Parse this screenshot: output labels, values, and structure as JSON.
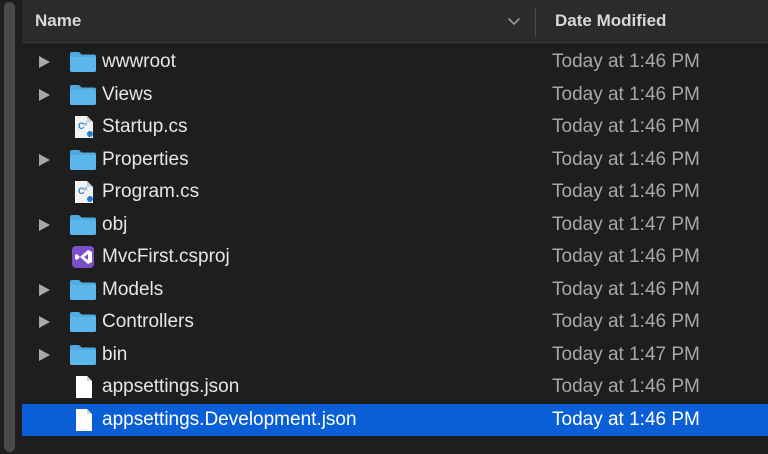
{
  "header": {
    "name_label": "Name",
    "date_label": "Date Modified",
    "sort_icon": "chevron-down-icon"
  },
  "colors": {
    "folder": "#4fa9e3",
    "selection": "#0a5fd6",
    "csharp": "#1e7fd6",
    "vs_purple": "#7b4fc9"
  },
  "files": [
    {
      "name": "wwwroot",
      "date": "Today at 1:46 PM",
      "kind": "folder",
      "expandable": true,
      "selected": false
    },
    {
      "name": "Views",
      "date": "Today at 1:46 PM",
      "kind": "folder",
      "expandable": true,
      "selected": false
    },
    {
      "name": "Startup.cs",
      "date": "Today at 1:46 PM",
      "kind": "csharp",
      "expandable": false,
      "selected": false
    },
    {
      "name": "Properties",
      "date": "Today at 1:46 PM",
      "kind": "folder",
      "expandable": true,
      "selected": false
    },
    {
      "name": "Program.cs",
      "date": "Today at 1:46 PM",
      "kind": "csharp",
      "expandable": false,
      "selected": false
    },
    {
      "name": "obj",
      "date": "Today at 1:47 PM",
      "kind": "folder",
      "expandable": true,
      "selected": false
    },
    {
      "name": "MvcFirst.csproj",
      "date": "Today at 1:46 PM",
      "kind": "csproj",
      "expandable": false,
      "selected": false
    },
    {
      "name": "Models",
      "date": "Today at 1:46 PM",
      "kind": "folder",
      "expandable": true,
      "selected": false
    },
    {
      "name": "Controllers",
      "date": "Today at 1:46 PM",
      "kind": "folder",
      "expandable": true,
      "selected": false
    },
    {
      "name": "bin",
      "date": "Today at 1:47 PM",
      "kind": "folder",
      "expandable": true,
      "selected": false
    },
    {
      "name": "appsettings.json",
      "date": "Today at 1:46 PM",
      "kind": "document",
      "expandable": false,
      "selected": false
    },
    {
      "name": "appsettings.Development.json",
      "date": "Today at 1:46 PM",
      "kind": "document",
      "expandable": false,
      "selected": true
    }
  ]
}
